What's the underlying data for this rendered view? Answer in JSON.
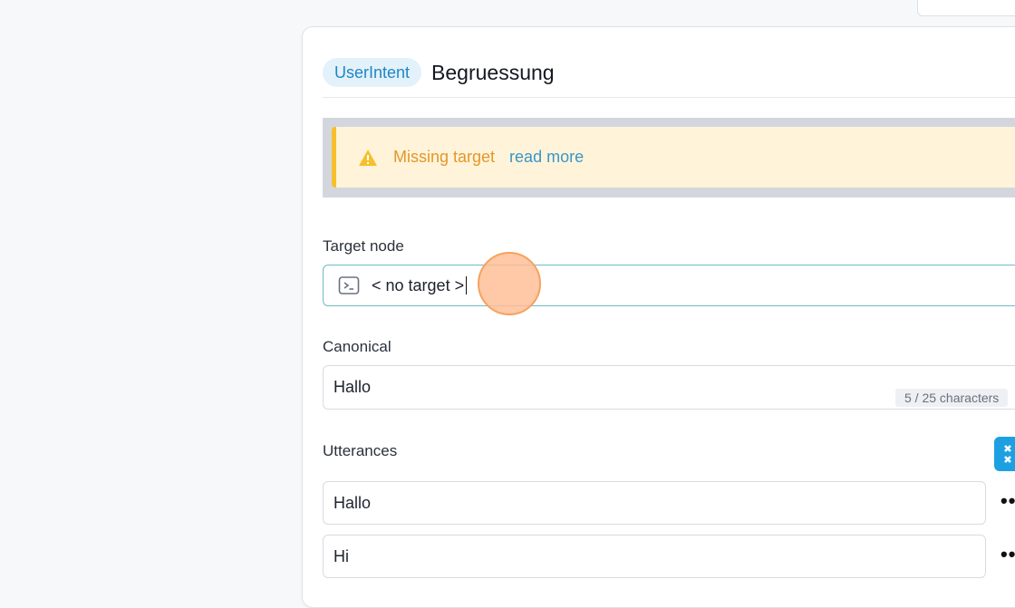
{
  "header": {
    "badge": "UserIntent",
    "title": "Begruessung"
  },
  "alert": {
    "message": "Missing target",
    "link": "read more",
    "color_text": "#e3962a",
    "color_border": "#f7bf2c"
  },
  "target_node": {
    "label": "Target node",
    "value": "< no target >"
  },
  "canonical": {
    "label": "Canonical",
    "value": "Hallo",
    "char_count": "5 / 25 characters"
  },
  "utterances": {
    "label": "Utterances",
    "items": [
      {
        "text": "Hallo",
        "menu": "••"
      },
      {
        "text": "Hi",
        "menu": "••"
      }
    ]
  },
  "colors": {
    "accent": "#1da0e2",
    "badge_bg": "#e3f1fb"
  }
}
